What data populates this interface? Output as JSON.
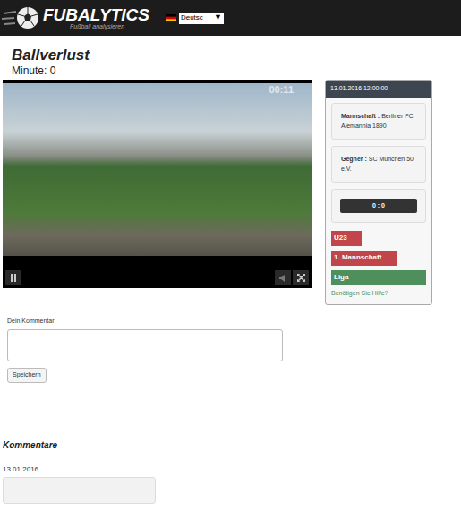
{
  "header": {
    "logo_title": "FUBALYTICS",
    "logo_subtitle": "Fußball analysieren",
    "language": "Deutsc",
    "language_arrow": "▼"
  },
  "event": {
    "title": "Ballverlust",
    "minute": "Minute: 0"
  },
  "player": {
    "time": "00:11"
  },
  "sidebar": {
    "datetime": "13.01.2016 12:00:00",
    "team": {
      "label": "Mannschaft :",
      "value": "Berliner FC Alemannia 1890"
    },
    "opponent": {
      "label": "Gegner :",
      "value": "SC München 50 e.V."
    },
    "score": "0 : 0",
    "tags": [
      {
        "label": "U23",
        "color": "#c0464b"
      },
      {
        "label": "1. Mannschaft",
        "color": "#c0464b"
      },
      {
        "label": "Liga",
        "color": "#4f8f5b"
      }
    ],
    "help": "Benötigen Sie Hilfe?"
  },
  "comment_form": {
    "label": "Dein Kommentar",
    "button": "Speichern"
  },
  "comments": {
    "heading": "Kommentare",
    "items": [
      {
        "date": "13.01.2016",
        "text": ""
      }
    ]
  }
}
